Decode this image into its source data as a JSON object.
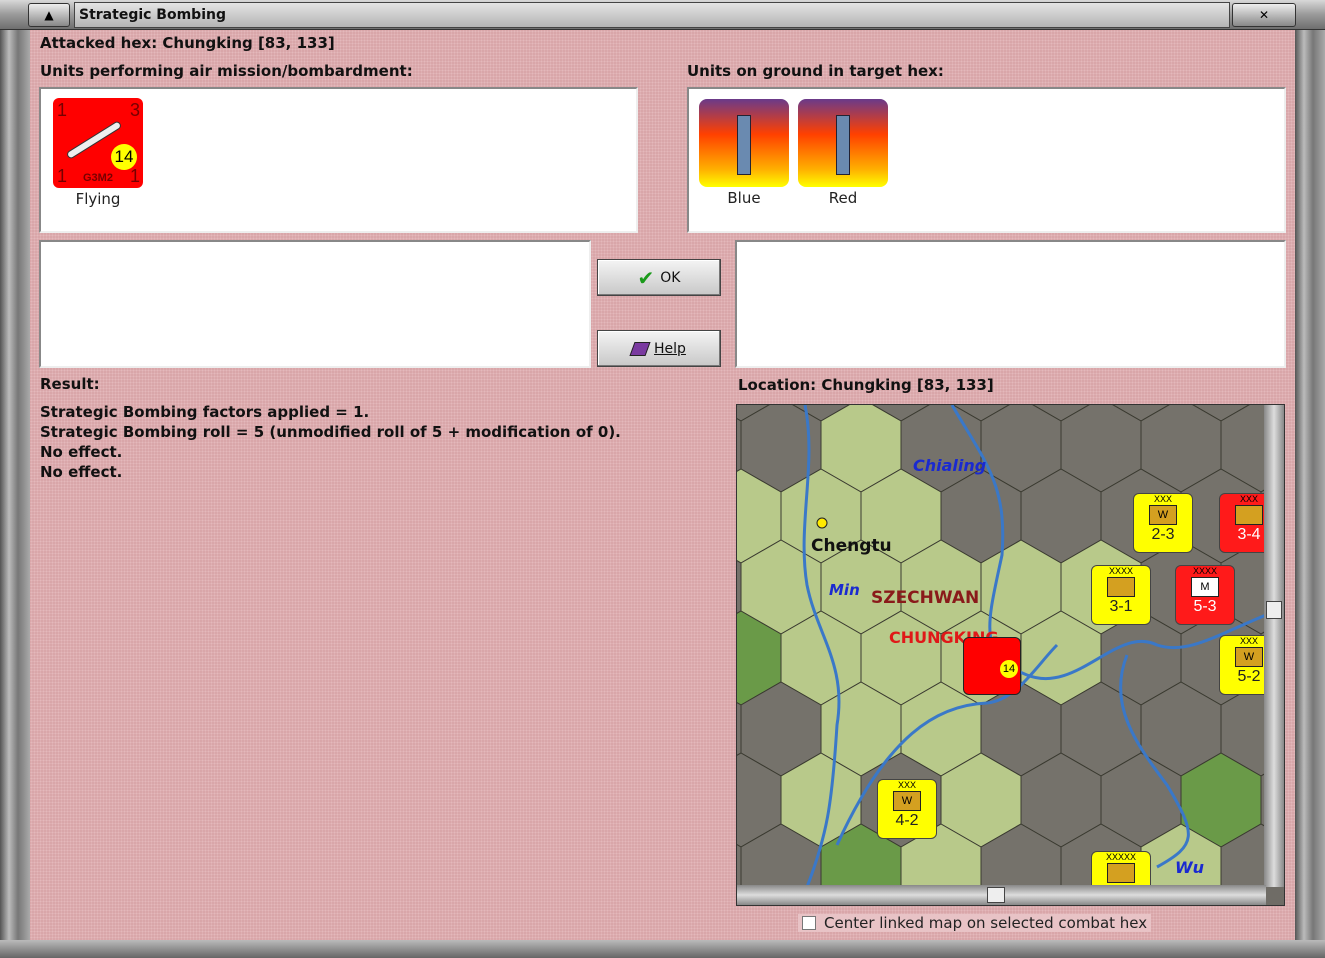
{
  "window": {
    "title": "Strategic Bombing"
  },
  "attacked_hex": "Attacked hex: Chungking  [83, 133]",
  "attackers": {
    "label": "Units performing air mission/bombardment:",
    "units": [
      {
        "name": "G3M2",
        "status": "Flying",
        "top_left": "1",
        "top_right": "3",
        "bottom_left": "1",
        "bottom_right": "1",
        "range": "14",
        "color": "#ff0000"
      }
    ]
  },
  "defenders": {
    "label": "Units on ground in target hex:",
    "units": [
      {
        "name": "Blue"
      },
      {
        "name": "Red"
      }
    ]
  },
  "buttons": {
    "ok": "OK",
    "help": "Help"
  },
  "result": {
    "label": "Result:",
    "lines": [
      "Strategic Bombing factors applied = 1.",
      "Strategic Bombing roll = 5 (unmodified roll of 5 + modification of 0).",
      "No effect.",
      "No effect."
    ]
  },
  "location": {
    "label": "Location:  Chungking  [83, 133]"
  },
  "map": {
    "place_labels": {
      "chengtu": "Chengtu",
      "szechwan": "SZECHWAN",
      "chungking": "CHUNGKING",
      "min": "Min",
      "chialing": "Chialing",
      "wu": "Wu"
    },
    "counters": [
      {
        "size": "XXX",
        "type": "W",
        "strength": "2-3",
        "side": "yellow"
      },
      {
        "size": "XXX",
        "type": "",
        "strength": "3-4",
        "side": "red"
      },
      {
        "size": "XXXX",
        "type": "",
        "strength": "3-1",
        "side": "yellow"
      },
      {
        "size": "XXXX",
        "type": "M",
        "strength": "5-3",
        "side": "red"
      },
      {
        "size": "XXX",
        "type": "W",
        "strength": "5-2",
        "side": "yellow"
      },
      {
        "size": "XXX",
        "type": "W",
        "strength": "4-2",
        "side": "yellow"
      },
      {
        "size": "XXXXX",
        "type": "",
        "strength": "",
        "side": "yellow"
      }
    ]
  },
  "center_checkbox": {
    "label": "Center linked map on selected combat hex",
    "checked": false
  },
  "colors": {
    "background": "#d9a6a9",
    "red_unit": "#ff0000",
    "yellow_unit": "#ffff00",
    "river": "#3a78c8"
  }
}
